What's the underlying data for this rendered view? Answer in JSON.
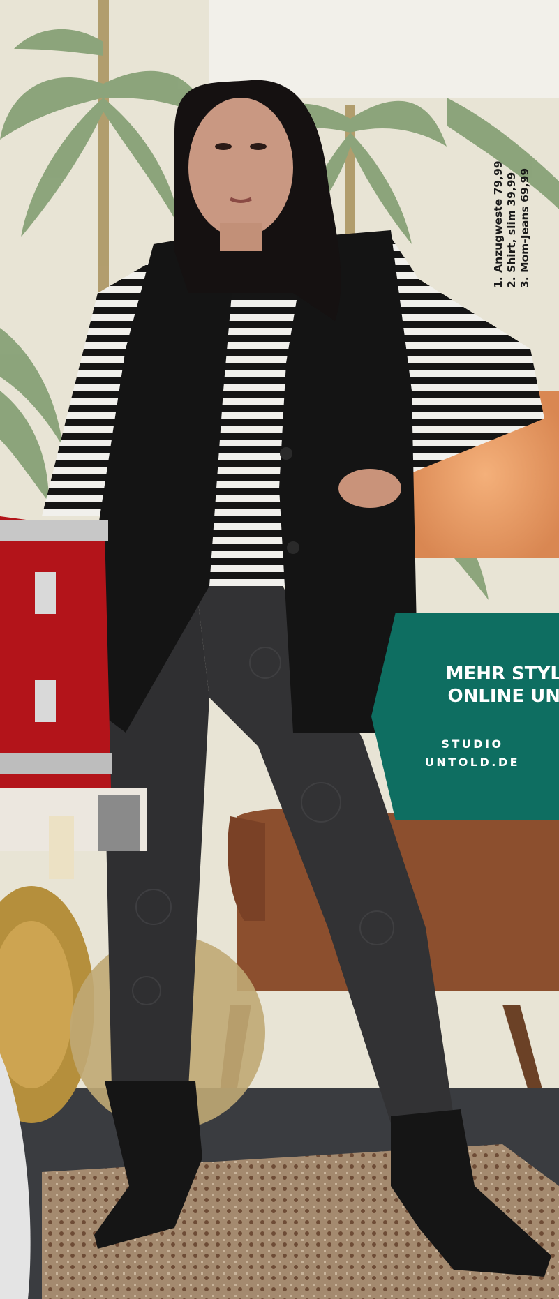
{
  "price_list": [
    "1. Anzugweste 79,99",
    "2. Shirt, slim 39,99",
    "3. Mom-Jeans 69,99"
  ],
  "promo": {
    "headline_line1": "MEHR STYLES",
    "headline_line2": "ONLINE UNTE",
    "link_line1": "STUDIO",
    "link_line2": "UNTOLD.DE",
    "color": "#0e6e61"
  }
}
